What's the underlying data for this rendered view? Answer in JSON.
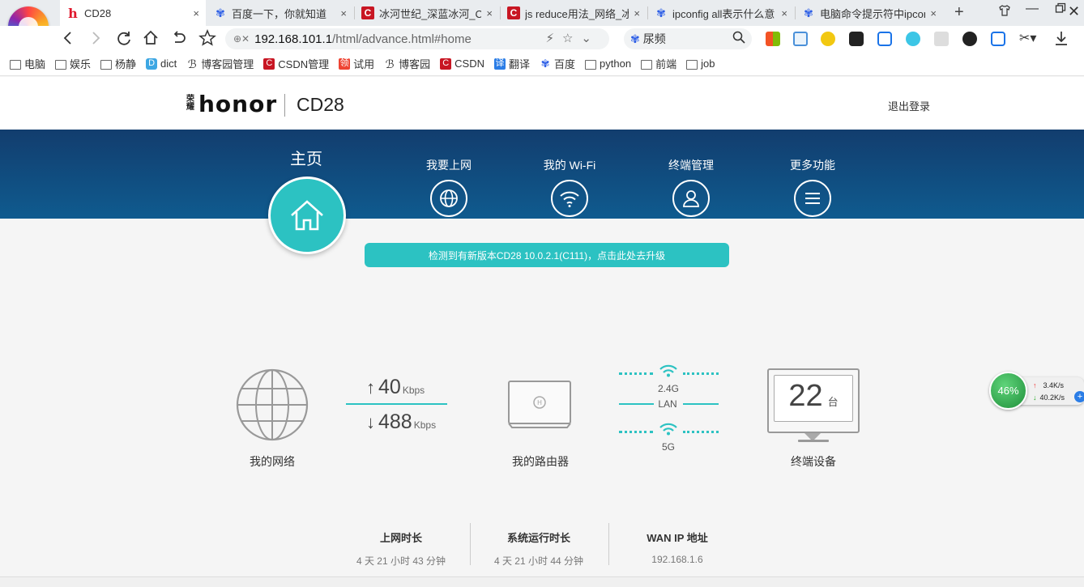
{
  "browser": {
    "tabs": [
      {
        "title": "CD28",
        "icon": "honor-h-icon"
      },
      {
        "title": "百度一下，你就知道",
        "icon": "baidu-paw-icon"
      },
      {
        "title": "冰河世纪_深蓝冰河_CSD",
        "icon": "csdn-icon"
      },
      {
        "title": "js reduce用法_网络_冰",
        "icon": "csdn-icon"
      },
      {
        "title": "ipconfig all表示什么意",
        "icon": "baidu-paw-icon"
      },
      {
        "title": "电脑命令提示符中ipcon",
        "icon": "baidu-paw-icon"
      }
    ],
    "close_glyph": "×",
    "new_tab_glyph": "+",
    "address": {
      "host": "192.168.101.1",
      "path": "/html/advance.html#home"
    },
    "search": {
      "value": "尿频"
    },
    "bookmarks": [
      {
        "label": "电脑",
        "icon": "folder"
      },
      {
        "label": "娱乐",
        "icon": "folder"
      },
      {
        "label": "杨静",
        "icon": "folder"
      },
      {
        "label": "dict",
        "icon": "dict"
      },
      {
        "label": "博客园管理",
        "icon": "cnblogs"
      },
      {
        "label": "CSDN管理",
        "icon": "csdn"
      },
      {
        "label": "试用",
        "icon": "lingyong"
      },
      {
        "label": "博客园",
        "icon": "cnblogs"
      },
      {
        "label": "CSDN",
        "icon": "csdn"
      },
      {
        "label": "翻译",
        "icon": "yi"
      },
      {
        "label": "百度",
        "icon": "baidu"
      },
      {
        "label": "python",
        "icon": "folder"
      },
      {
        "label": "前端",
        "icon": "folder"
      },
      {
        "label": "job",
        "icon": "folder"
      }
    ]
  },
  "router": {
    "brand": "honor",
    "brand_small": "荣耀",
    "model": "CD28",
    "logout": "退出登录",
    "nav": {
      "home": "主页",
      "internet": "我要上网",
      "wifi": "我的 Wi-Fi",
      "devices": "终端管理",
      "more": "更多功能"
    },
    "upgrade_notice": "检测到有新版本CD28 10.0.2.1(C111)，点击此处去升级",
    "diagram": {
      "network_label": "我的网络",
      "upload": {
        "value": "40",
        "unit": "Kbps"
      },
      "download": {
        "value": "488",
        "unit": "Kbps"
      },
      "router_label": "我的路由器",
      "band_24": "2.4G",
      "band_lan": "LAN",
      "band_5": "5G",
      "device_count": "22",
      "device_unit": "台",
      "devices_label": "终端设备"
    },
    "stats": [
      {
        "heading": "上网时长",
        "value": "4 天 21 小时 43 分钟"
      },
      {
        "heading": "系统运行时长",
        "value": "4 天 21 小时 44 分钟"
      },
      {
        "heading": "WAN IP 地址",
        "value": "192.168.1.6"
      }
    ]
  },
  "speed_widget": {
    "percent": "46%",
    "up": "3.4K/s",
    "down": "40.2K/s"
  },
  "colors": {
    "teal": "#2cc2c2",
    "nav_band": "#0f4f84"
  }
}
